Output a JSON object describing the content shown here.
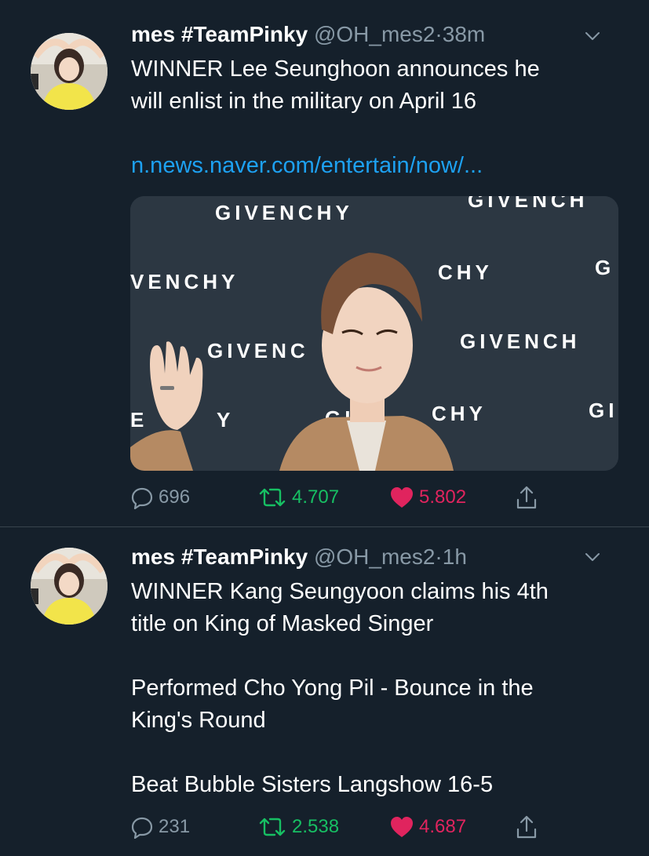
{
  "colors": {
    "background": "#15202b",
    "text": "#ffffff",
    "muted": "#8899a6",
    "link": "#1da1f2",
    "retweet": "#17bf63",
    "like": "#e0245e",
    "divider": "#38444d"
  },
  "tweets": [
    {
      "author": {
        "name": "mes #TeamPinky",
        "handle": "@OH_mes2",
        "avatar_icon": "avatar-photo"
      },
      "separator": "·",
      "time": "38m",
      "text_lines": [
        "WINNER Lee Seunghoon announces he",
        "will enlist in the military on April 16"
      ],
      "link": "n.news.naver.com/entertain/now/...",
      "media": {
        "backdrop_words": [
          "GIVENCHY",
          "GIVENCH",
          "VENCHY",
          "CHY",
          "G",
          "GIVENC",
          "GIVENCH",
          "E",
          "Y",
          "GI",
          "CHY",
          "GI"
        ]
      },
      "stats": {
        "replies": "696",
        "retweets": "4.707",
        "likes": "5.802"
      },
      "icons": {
        "reply": "reply-icon",
        "retweet": "retweet-icon",
        "like": "heart-icon",
        "share": "share-icon",
        "menu": "chevron-down-icon"
      }
    },
    {
      "author": {
        "name": "mes #TeamPinky",
        "handle": "@OH_mes2",
        "avatar_icon": "avatar-photo"
      },
      "separator": "·",
      "time": "1h",
      "paragraphs": [
        [
          "WINNER Kang Seungyoon claims his 4th",
          "title on King of Masked Singer"
        ],
        [
          "Performed Cho Yong Pil - Bounce in the",
          "King's Round"
        ],
        [
          "Beat Bubble Sisters Langshow 16-5"
        ]
      ],
      "stats": {
        "replies": "231",
        "retweets": "2.538",
        "likes": "4.687"
      },
      "icons": {
        "reply": "reply-icon",
        "retweet": "retweet-icon",
        "like": "heart-icon",
        "share": "share-icon",
        "menu": "chevron-down-icon"
      }
    }
  ]
}
